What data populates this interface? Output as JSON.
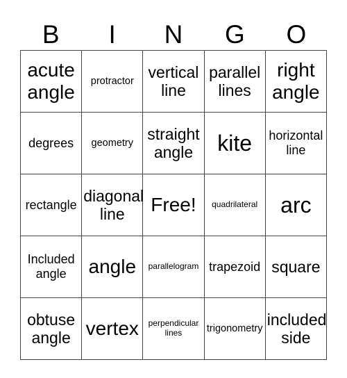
{
  "header": {
    "letters": [
      "B",
      "I",
      "N",
      "G",
      "O"
    ]
  },
  "cells": [
    [
      "acute angle",
      "protractor",
      "vertical line",
      "parallel lines",
      "right angle"
    ],
    [
      "degrees",
      "geometry",
      "straight angle",
      "kite",
      "horizontal line"
    ],
    [
      "rectangle",
      "diagonal line",
      "Free!",
      "quadrilateral",
      "arc"
    ],
    [
      "Included angle",
      "angle",
      "parallelogram",
      "trapezoid",
      "square"
    ],
    [
      "obtuse angle",
      "vertex",
      "perpendicular lines",
      "trigonometry",
      "included side"
    ]
  ]
}
